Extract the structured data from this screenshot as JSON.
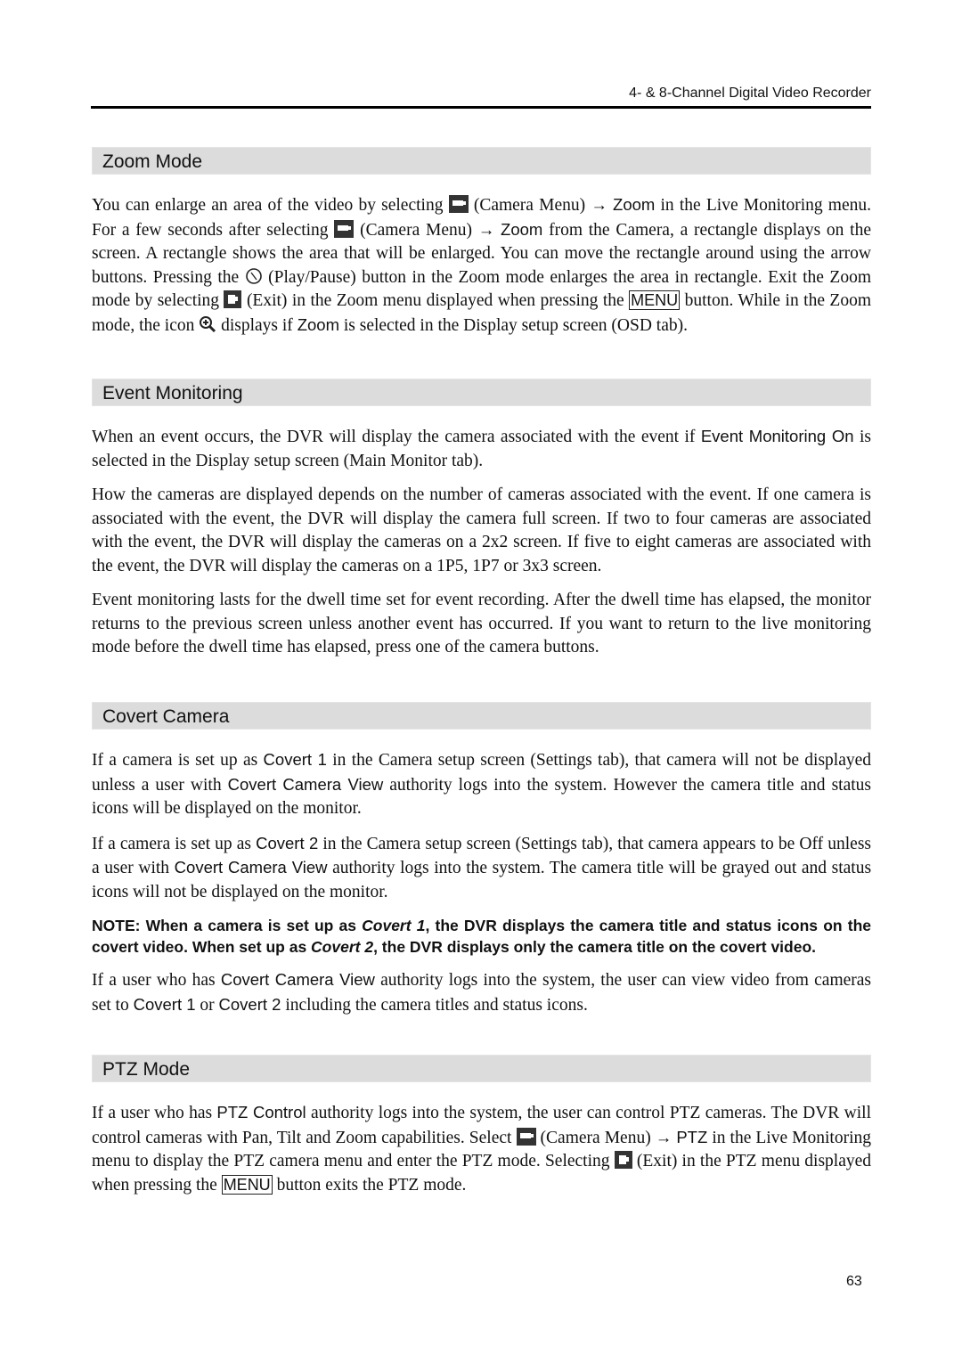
{
  "header": {
    "running_title": "4- & 8-Channel Digital Video Recorder"
  },
  "zoom_mode": {
    "title": "Zoom Mode",
    "p1": {
      "t1": "You can enlarge an area of the video by selecting",
      "t2": "(Camera Menu)",
      "arrow": "→",
      "ui1": "Zoom",
      "t3": "in the Live Monitoring menu.  For a few seconds after selecting",
      "t4": "(Camera Menu)",
      "ui2": "Zoom",
      "t5": "from the Camera, a rectangle displays on the screen.  A rectangle shows the area that will be enlarged.  You can move the rectangle around using the arrow buttons.  Pressing the",
      "t6": "(Play/Pause) button in the Zoom mode enlarges the area in rectangle.  Exit the Zoom mode by selecting",
      "t7": "(Exit) in the Zoom menu displayed when pressing the",
      "key": "MENU",
      "t8": "button.  While in the Zoom mode, the icon",
      "t9": "displays if",
      "ui3": "Zoom",
      "t10": "is selected in the Display setup screen (OSD tab)."
    }
  },
  "event_monitoring": {
    "title": "Event Monitoring",
    "p1": {
      "t1": "When an event occurs, the DVR will display the camera associated with the event if",
      "ui": "Event Monitoring On",
      "t2": "is selected in the Display setup screen (Main Monitor tab)."
    },
    "p2": "How the cameras are displayed depends on the number of cameras associated with the event.  If one camera is associated with the event, the DVR will display the camera full screen.  If two to four cameras are associated with the event, the DVR will display the cameras on a 2x2 screen.  If five to eight cameras are associated with the event, the DVR will display the cameras on a 1P5, 1P7 or 3x3 screen.",
    "p3": "Event monitoring lasts for the dwell time set for event recording.  After the dwell time has elapsed, the monitor returns to the previous screen unless another event has occurred.  If you want to return to the live monitoring mode before the dwell time has elapsed, press one of the camera buttons."
  },
  "covert_camera": {
    "title": "Covert Camera",
    "p1": {
      "t1": "If a camera is set up as",
      "ui1": "Covert 1",
      "t2": "in the Camera setup screen (Settings tab), that camera will not be displayed unless a user with",
      "ui2": "Covert Camera View",
      "t3": "authority logs into the system.  However the camera title and status icons will be displayed on the monitor."
    },
    "p2": {
      "t1": "If a camera is set up as",
      "ui1": "Covert 2",
      "t2": "in the Camera setup screen (Settings tab), that camera appears to be Off unless a user with",
      "ui2": "Covert Camera View",
      "t3": "authority logs into the system.  The camera title will be grayed out and status icons will not be displayed on the monitor."
    },
    "note": {
      "t1": "NOTE:  When a camera is set up as",
      "i1": "Covert 1",
      "t2": ", the DVR displays the camera title and status icons on the covert video.  When set up as",
      "i2": "Covert 2",
      "t3": ", the DVR displays only the camera title on the covert video."
    },
    "p3": {
      "t1": "If a user who has",
      "ui1": "Covert Camera View",
      "t2": "authority logs into the system, the user can view video from cameras set to",
      "ui2": "Covert 1",
      "t3": "or",
      "ui3": "Covert 2",
      "t4": "including the camera titles and status icons."
    }
  },
  "ptz_mode": {
    "title": "PTZ Mode",
    "p1": {
      "t1": "If a user who has",
      "ui1": "PTZ Control",
      "t2": "authority logs into the system, the user can control PTZ cameras. The DVR will control cameras with Pan, Tilt and Zoom capabilities.  Select",
      "t3": "(Camera Menu)",
      "arrow": "→",
      "ui2": "PTZ",
      "t4": "in the Live Monitoring menu to display the PTZ camera menu and enter the PTZ mode. Selecting",
      "t5": "(Exit) in the PTZ menu displayed when pressing the",
      "key": "MENU",
      "t6": "button exits the PTZ mode."
    }
  },
  "footer": {
    "page_number": "63"
  }
}
